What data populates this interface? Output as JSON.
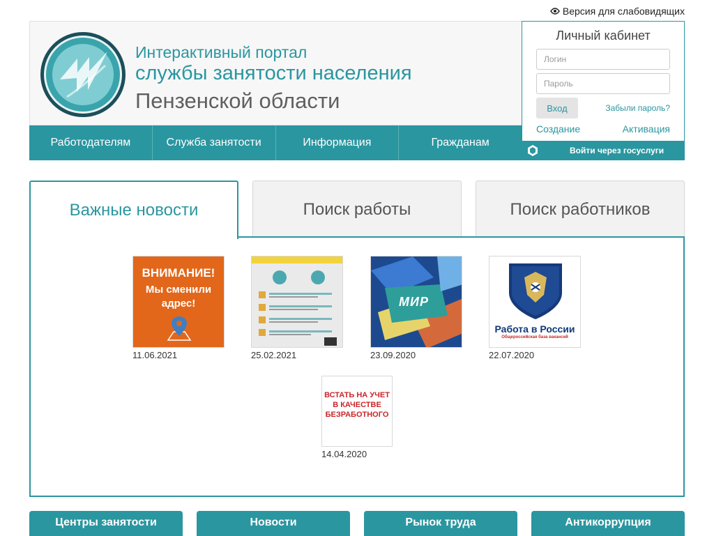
{
  "accessibility": {
    "label": "Версия для слабовидящих",
    "icon": "eye-icon"
  },
  "header": {
    "title_line1": "Интерактивный портал",
    "title_line2": "службы занятости населения",
    "title_line3": "Пензенской области",
    "logo_icon": "portal-logo"
  },
  "nav": {
    "items": [
      {
        "label": "Работодателям"
      },
      {
        "label": "Служба занятости"
      },
      {
        "label": "Информация"
      },
      {
        "label": "Гражданам"
      }
    ]
  },
  "cabinet": {
    "title": "Личный кабинет",
    "login_placeholder": "Логин",
    "password_placeholder": "Пароль",
    "login_button": "Вход",
    "forgot": "Забыли пароль?",
    "create": "Создание",
    "activate": "Активация",
    "gosuslugi": "Войти через госуслуги"
  },
  "tabs": [
    {
      "label": "Важные новости",
      "active": true
    },
    {
      "label": "Поиск работы",
      "active": false
    },
    {
      "label": "Поиск работников",
      "active": false
    }
  ],
  "news": [
    {
      "date": "11.06.2021",
      "image_text_1": "ВНИМАНИЕ!",
      "image_text_2": "Мы сменили адрес!"
    },
    {
      "date": "25.02.2021"
    },
    {
      "date": "23.09.2020",
      "image_text": "МИР"
    },
    {
      "date": "22.07.2020",
      "image_text_1": "Работа в России",
      "image_text_2": "Общероссийская база вакансий"
    },
    {
      "date": "14.04.2020",
      "image_text": "ВСТАТЬ НА УЧЕТ В КАЧЕСТВЕ БЕЗРАБОТНОГО"
    }
  ],
  "bottom_tabs": [
    {
      "label": "Центры занятости"
    },
    {
      "label": "Новости"
    },
    {
      "label": "Рынок труда"
    },
    {
      "label": "Антикоррупция"
    }
  ],
  "colors": {
    "accent": "#2a96a0",
    "orange": "#e2671b",
    "red": "#c8262a"
  }
}
